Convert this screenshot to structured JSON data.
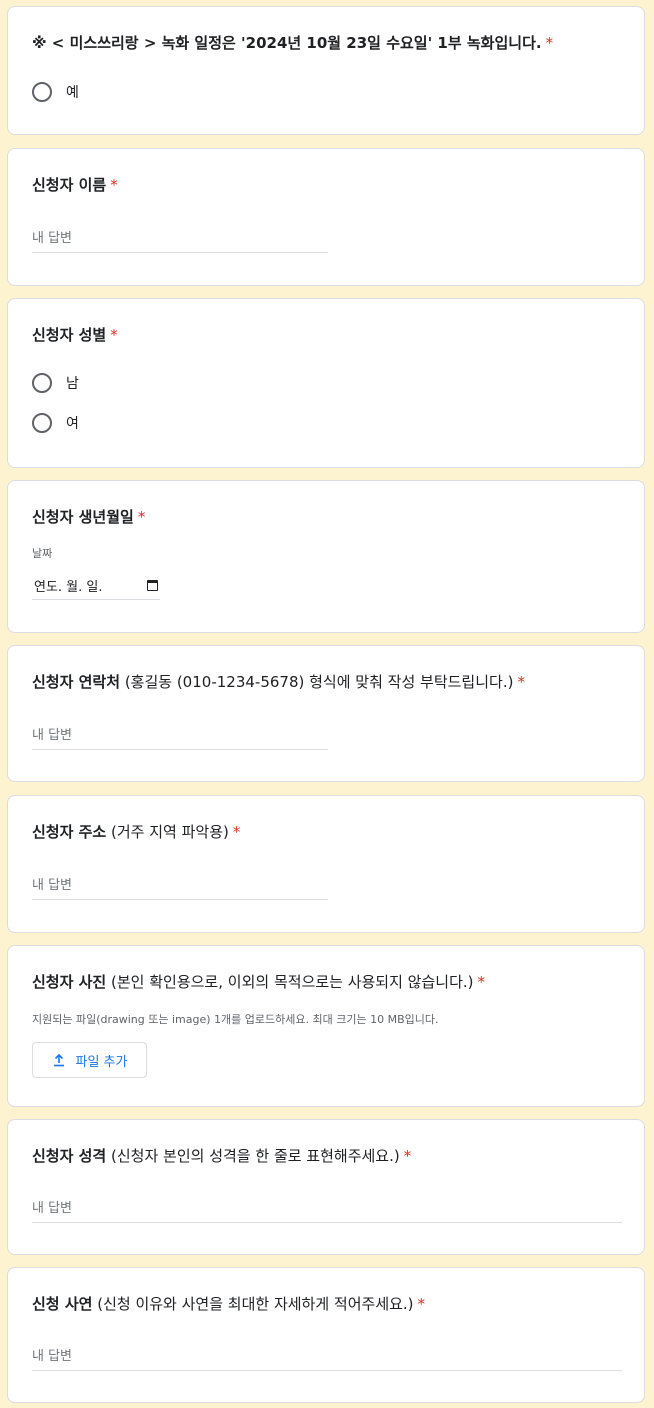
{
  "questions": {
    "recording": {
      "title": "※ < 미스쓰리랑 >  녹화 일정은 '2024년 10월 23일 수요일' 1부 녹화입니다.",
      "options": [
        "예"
      ]
    },
    "name": {
      "title": "신청자 이름",
      "placeholder": "내 답변"
    },
    "gender": {
      "title": "신청자 성별",
      "options": [
        "남",
        "여"
      ]
    },
    "birthdate": {
      "title": "신청자 생년월일",
      "date_label": "날짜",
      "date_placeholder": "연도. 월. 일."
    },
    "contact": {
      "title": "신청자 연락처",
      "hint": "(홍길동 (010-1234-5678) 형식에 맞춰 작성 부탁드립니다.)",
      "placeholder": "내 답변"
    },
    "address": {
      "title": "신청자 주소",
      "hint": "(거주 지역 파악용)",
      "placeholder": "내 답변"
    },
    "photo": {
      "title": "신청자 사진",
      "hint": "(본인 확인용으로, 이외의 목적으로는 사용되지 않습니다.)",
      "note": "지원되는 파일(drawing 또는 image) 1개를 업로드하세요. 최대 크기는 10 MB입니다.",
      "upload_label": "파일 추가"
    },
    "personality": {
      "title": "신청자 성격",
      "hint": "(신청자 본인의 성격을 한 줄로 표현해주세요.)",
      "placeholder": "내 답변"
    },
    "story": {
      "title": "신청 사연",
      "hint": "(신청 이유와 사연을 최대한 자세하게 적어주세요.)",
      "placeholder": "내 답변"
    }
  },
  "required_mark": "*",
  "colors": {
    "background": "#fdf3d0",
    "required": "#d93025",
    "accent": "#1a73e8"
  }
}
